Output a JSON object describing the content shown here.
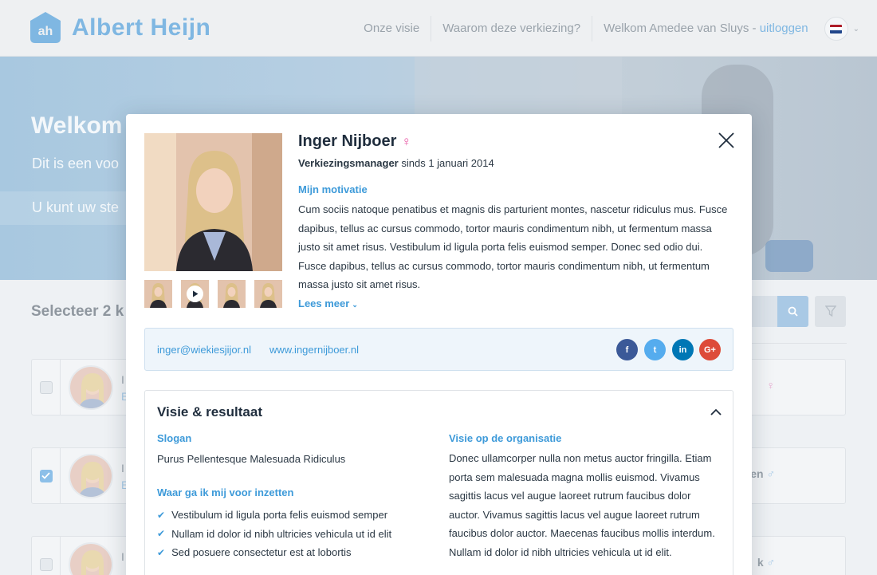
{
  "header": {
    "brand": "Albert Heijn",
    "nav": [
      "Onze visie",
      "Waarom deze verkiezing?"
    ],
    "welcome": "Welkom Amedee van Sluys -",
    "logout": "uitloggen",
    "flag_colors": [
      "#ae1c28",
      "#ffffff",
      "#21468b"
    ]
  },
  "hero": {
    "title": "Welkom",
    "subtitle": "Dit is een voo",
    "cta": "U kunt uw ste"
  },
  "listing": {
    "select_label": "Selecteer 2 k",
    "cards": [
      {
        "name_fragment": "I",
        "sub_fragment": "E",
        "checked": false,
        "right": "",
        "gender_icon": "♀"
      },
      {
        "name_fragment": "I",
        "sub_fragment": "E",
        "checked": true,
        "right": "ken",
        "gender_icon": "♂"
      },
      {
        "name_fragment": "I",
        "sub_fragment": "",
        "checked": false,
        "right": "k",
        "gender_icon": "♂"
      }
    ]
  },
  "modal": {
    "name": "Inger Nijboer",
    "gender_icon": "♀",
    "role": "Verkiezingsmanager",
    "since": "sinds 1 januari 2014",
    "motivation_label": "Mijn motivatie",
    "motivation_text": "Cum sociis natoque penatibus et magnis dis parturient montes, nascetur ridiculus mus. Fusce dapibus, tellus ac cursus commodo, tortor mauris condimentum nibh, ut fermentum massa justo sit amet risus. Vestibulum id ligula porta felis euismod semper. Donec sed odio dui. Fusce dapibus, tellus ac cursus commodo, tortor mauris condimentum nibh, ut fermentum massa justo sit amet risus.",
    "read_more": "Lees meer",
    "email": "inger@wiekiesjijor.nl",
    "website": "www.ingernijboer.nl",
    "social": [
      {
        "label": "f",
        "name": "facebook",
        "color": "#3b5998"
      },
      {
        "label": "t",
        "name": "twitter",
        "color": "#55acee"
      },
      {
        "label": "in",
        "name": "linkedin",
        "color": "#0077b5"
      },
      {
        "label": "G+",
        "name": "google-plus",
        "color": "#dd4b39"
      }
    ],
    "panel": {
      "title": "Visie & resultaat",
      "slogan_label": "Slogan",
      "slogan": "Purus Pellentesque Malesuada Ridiculus",
      "goals_label": "Waar ga ik mij voor inzetten",
      "goals": [
        "Vestibulum id ligula porta felis euismod semper",
        "Nullam id dolor id nibh ultricies vehicula ut id elit",
        "Sed posuere consectetur est at lobortis"
      ],
      "vision_label": "Visie op de organisatie",
      "vision_text": "Donec ullamcorper nulla non metus auctor fringilla. Etiam porta sem malesuada magna mollis euismod. Vivamus sagittis lacus vel augue laoreet rutrum faucibus dolor auctor. Vivamus sagittis lacus vel augue laoreet rutrum faucibus dolor auctor. Maecenas faucibus mollis interdum. Nullam id dolor id nibh ultricies vehicula ut id elit."
    }
  }
}
